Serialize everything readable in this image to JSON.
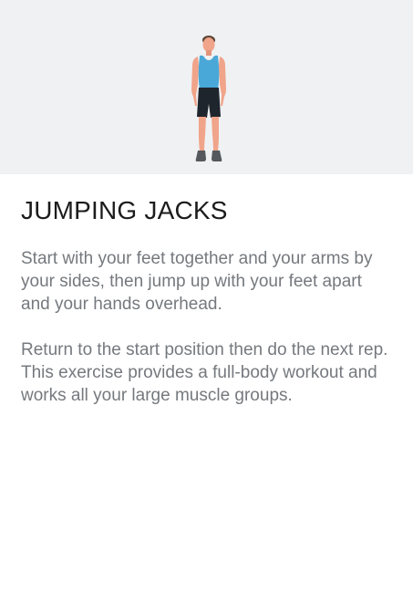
{
  "exercise": {
    "title": "JUMPING JACKS",
    "illustration_icon": "standing-person-illustration",
    "description": [
      "Start with your feet together and your arms by your sides, then jump up with your feet apart and your hands overhead.",
      "Return to the start position then do the next rep. This exercise provides a full-body workout and works all your large muscle groups."
    ]
  },
  "colors": {
    "hero_background": "#eff1f3",
    "title_text": "#1c1c1c",
    "body_text": "#75797e",
    "tank_top": "#4aa8d8",
    "shorts": "#1f252c",
    "skin": "#f0a48a",
    "shoes": "#55585c"
  }
}
